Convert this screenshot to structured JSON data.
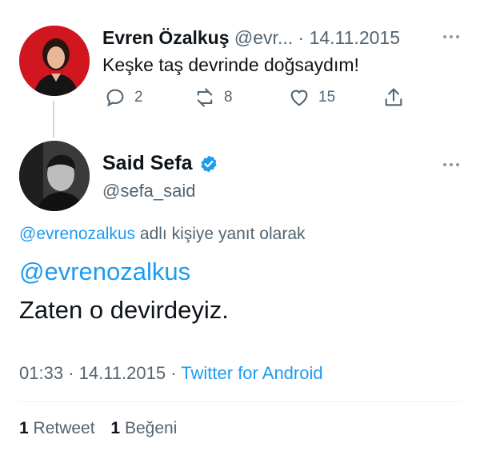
{
  "parent_tweet": {
    "author_name": "Evren Özalkuş",
    "handle_truncated": "@evr...",
    "separator": "·",
    "date": "14.11.2015",
    "text": "Keşke taş devrinde doğsaydım!",
    "replies": "2",
    "retweets": "8",
    "likes": "15",
    "avatar_color": "#d0171f"
  },
  "main_tweet": {
    "author_name": "Said Sefa",
    "handle": "@sefa_said",
    "verified_color": "#1d9bf0",
    "reply_to_handle": "@evrenozalkus",
    "reply_to_suffix": "adlı kişiye yanıt olarak",
    "mention": "@evrenozalkus",
    "text": "Zaten o devirdeyiz.",
    "time": "01:33",
    "separator1": "·",
    "date": "14.11.2015",
    "separator2": "·",
    "source": "Twitter for Android"
  },
  "stats": {
    "retweet_count": "1",
    "retweet_label": "Retweet",
    "like_count": "1",
    "like_label": "Beğeni"
  },
  "colors": {
    "accent": "#1d9bf0",
    "muted": "#536471"
  }
}
